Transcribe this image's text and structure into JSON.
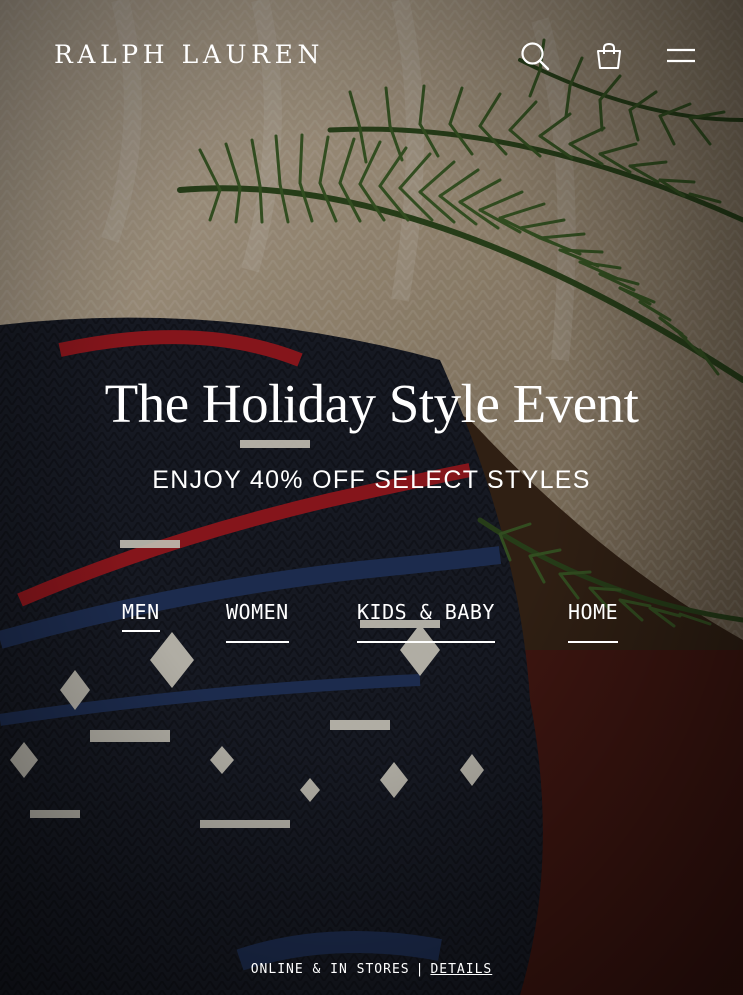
{
  "header": {
    "logo_text": "RALPH LAUREN",
    "icons": [
      "search-icon",
      "shopping-bag-icon",
      "menu-icon"
    ]
  },
  "hero": {
    "title": "The Holiday Style Event",
    "subtitle": "ENJOY 40% OFF SELECT STYLES",
    "categories": [
      {
        "label": "MEN"
      },
      {
        "label": "WOMEN"
      },
      {
        "label": "KIDS & BABY"
      },
      {
        "label": "HOME"
      }
    ]
  },
  "footer": {
    "availability": "ONLINE & IN STORES",
    "separator": "|",
    "details_link": "DETAILS"
  },
  "colors": {
    "text": "#ffffff",
    "knit_cream": "#d9cdbb",
    "knit_navy": "#1b1f2a",
    "pine_green": "#2f4a1e",
    "accent_red": "#a31a22"
  }
}
